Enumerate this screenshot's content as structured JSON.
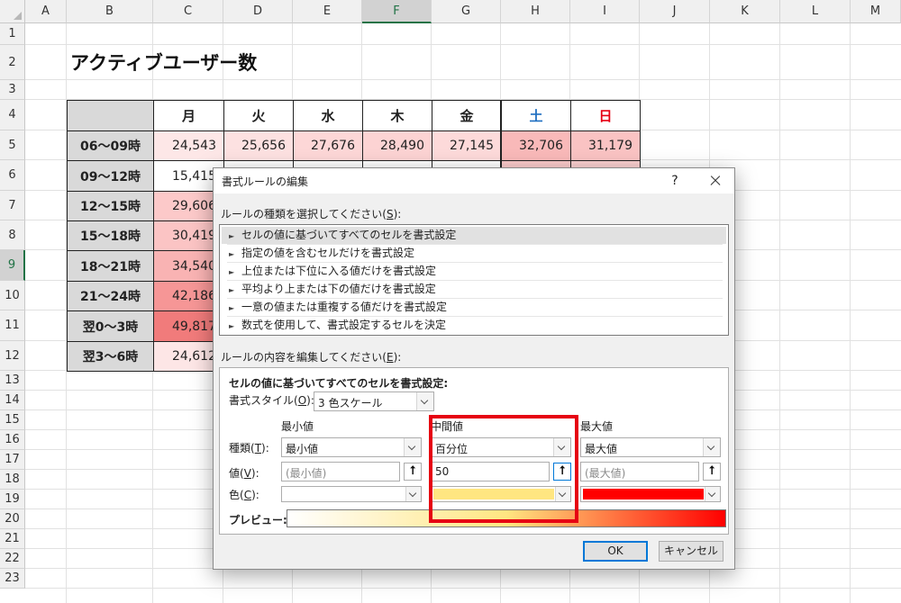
{
  "sheet": {
    "columns": [
      "A",
      "B",
      "C",
      "D",
      "E",
      "F",
      "G",
      "H",
      "I",
      "J",
      "K",
      "L",
      "M"
    ],
    "selected_column": "F",
    "rows": [
      "1",
      "2",
      "3",
      "4",
      "5",
      "6",
      "7",
      "8",
      "9",
      "10",
      "11",
      "12",
      "13",
      "14",
      "15",
      "16",
      "17",
      "18",
      "19",
      "20",
      "21",
      "22",
      "23"
    ],
    "selected_row": "9",
    "title": "アクティブユーザー数",
    "table": {
      "days": [
        "月",
        "火",
        "水",
        "木",
        "金",
        "土",
        "日"
      ],
      "day_colors": [
        "#222222",
        "#222222",
        "#222222",
        "#222222",
        "#222222",
        "#1f6fc1",
        "#e60012"
      ],
      "rows": [
        {
          "label": "06〜09時",
          "values": [
            "24,543",
            "25,656",
            "27,676",
            "28,490",
            "27,145",
            "32,706",
            "31,179"
          ],
          "fills": [
            "#fde7e7",
            "#fde1e1",
            "#fdd7d7",
            "#fcd3d3",
            "#fddada",
            "#f9b9b9",
            "#fac3c3"
          ]
        },
        {
          "label": "09〜12時",
          "values": [
            "15,415"
          ],
          "fills": [
            "#ffffff",
            "#ffffff",
            "#ffffff",
            "#ffffff",
            "#ffffff",
            "#fbcaca",
            "#fbd0d0"
          ]
        },
        {
          "label": "12〜15時",
          "values": [
            "29,606"
          ],
          "fills": [
            "#fcc9c9"
          ]
        },
        {
          "label": "15〜18時",
          "values": [
            "30,419"
          ],
          "fills": [
            "#fbc4c4"
          ]
        },
        {
          "label": "18〜21時",
          "values": [
            "34,540"
          ],
          "fills": [
            "#f9b3b3"
          ]
        },
        {
          "label": "21〜24時",
          "values": [
            "42,186"
          ],
          "fills": [
            "#f69696"
          ]
        },
        {
          "label": "翌0〜3時",
          "values": [
            "49,817"
          ],
          "fills": [
            "#f17b7b"
          ]
        },
        {
          "label": "翌3〜6時",
          "values": [
            "24,612"
          ],
          "fills": [
            "#fde6e6"
          ]
        }
      ]
    }
  },
  "dialog": {
    "title": "書式ルールの編集",
    "help": "?",
    "rule_type_label": "ルールの種類を選択してください(",
    "rule_type_key": "S",
    "rule_types": [
      "セルの値に基づいてすべてのセルを書式設定",
      "指定の値を含むセルだけを書式設定",
      "上位または下位に入る値だけを書式設定",
      "平均より上または下の値だけを書式設定",
      "一意の値または重複する値だけを書式設定",
      "数式を使用して、書式設定するセルを決定"
    ],
    "rule_edit_label": "ルールの内容を編集してください(",
    "rule_edit_key": "E",
    "section_title": "セルの値に基づいてすべてのセルを書式設定:",
    "style_label": "書式スタイル(",
    "style_key": "O",
    "style_value": "3 色スケール",
    "type_label": "種類(",
    "type_key": "T",
    "value_label": "値(",
    "value_key": "V",
    "color_label": "色(",
    "color_key": "C",
    "preview_label": "プレビュー:",
    "min": {
      "header": "最小値",
      "type": "最小値",
      "value_placeholder": "(最小値)",
      "color": "#ffffff"
    },
    "mid": {
      "header": "中間値",
      "type": "百分位",
      "value": "50",
      "color": "#ffe681"
    },
    "max": {
      "header": "最大値",
      "type": "最大値",
      "value_placeholder": "(最大値)",
      "color": "#ff0000"
    },
    "ok": "OK",
    "cancel": "キャンセル"
  },
  "colors": {
    "highlight_box": "#e60012",
    "excel_green": "#217346",
    "accent_blue": "#0078d7"
  }
}
